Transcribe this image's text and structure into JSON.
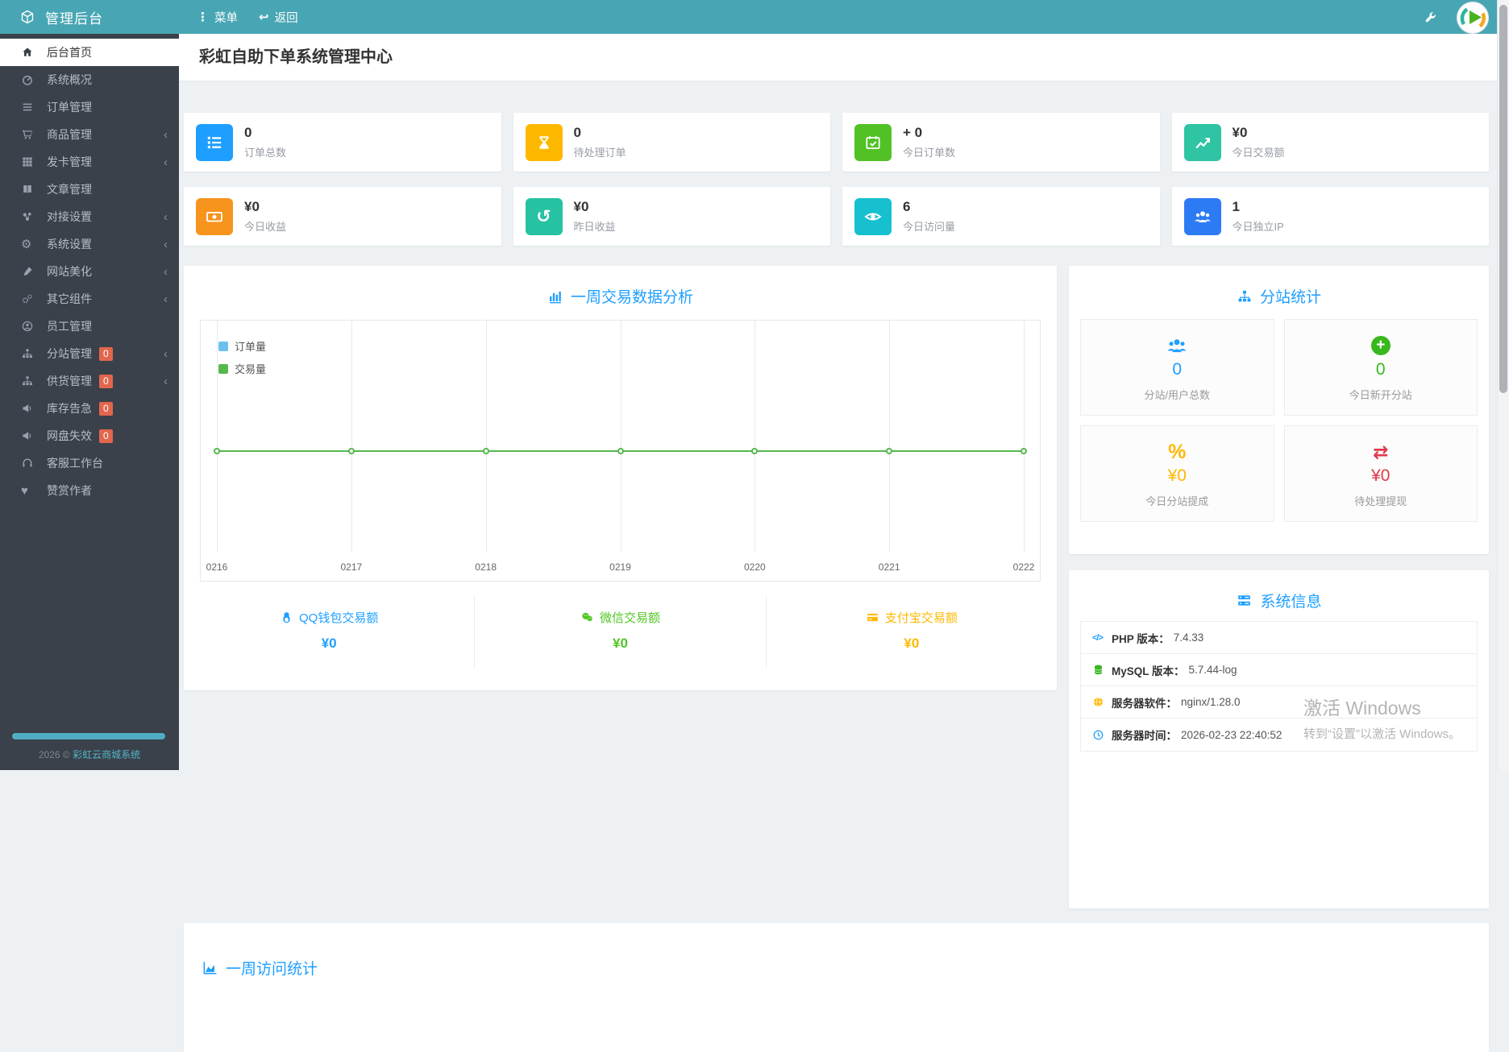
{
  "theme": {
    "accent": "#1E9FFF",
    "header": "#48A6B4",
    "sidebar": "#3A414B",
    "badge": "#E2664D",
    "body_bg": "#EEF1F4"
  },
  "header": {
    "app_title": "管理后台",
    "menu_label": "菜单",
    "back_label": "返回"
  },
  "icons": {
    "kebab": "⋮",
    "back": "↩",
    "gear": "⚙",
    "heart": "♥",
    "history": "↺",
    "exchange": "⇄",
    "percent": "%",
    "plus": "+",
    "code": "</>",
    "chevron": "‹"
  },
  "sidebar": {
    "items": [
      {
        "label": "后台首页",
        "icon": "home-icon",
        "active": true
      },
      {
        "label": "系统概况",
        "icon": "gauge-icon"
      },
      {
        "label": "订单管理",
        "icon": "list-icon"
      },
      {
        "label": "商品管理",
        "icon": "cart-icon",
        "expandable": true
      },
      {
        "label": "发卡管理",
        "icon": "grid-icon",
        "expandable": true
      },
      {
        "label": "文章管理",
        "icon": "book-icon"
      },
      {
        "label": "对接设置",
        "icon": "nodes-icon",
        "expandable": true
      },
      {
        "label": "系统设置",
        "icon": "gear-icon",
        "expandable": true
      },
      {
        "label": "网站美化",
        "icon": "brush-icon",
        "expandable": true
      },
      {
        "label": "其它组件",
        "icon": "cogs-icon",
        "expandable": true
      },
      {
        "label": "员工管理",
        "icon": "user-circle-icon"
      },
      {
        "label": "分站管理",
        "icon": "sitemap-icon",
        "badge": "0",
        "expandable": true
      },
      {
        "label": "供货管理",
        "icon": "sitemap-icon",
        "badge": "0",
        "expandable": true
      },
      {
        "label": "库存告急",
        "icon": "megaphone-icon",
        "badge": "0"
      },
      {
        "label": "网盘失效",
        "icon": "megaphone-icon",
        "badge": "0"
      },
      {
        "label": "客服工作台",
        "icon": "headset-icon"
      },
      {
        "label": "赞赏作者",
        "icon": "heart-icon"
      }
    ],
    "footer": {
      "year_text": "2026 ©",
      "brand": "彩虹云商城系统"
    }
  },
  "page": {
    "title": "彩虹自助下单系统管理中心"
  },
  "stats": [
    {
      "value": "0",
      "label": "订单总数",
      "icon": "order-list-icon",
      "color": "#1E9FFF"
    },
    {
      "value": "0",
      "label": "待处理订单",
      "icon": "hourglass-icon",
      "color": "#FFB800"
    },
    {
      "value": "+ 0",
      "label": "今日订单数",
      "icon": "calendar-check-icon",
      "color": "#52C125"
    },
    {
      "value": "¥0",
      "label": "今日交易额",
      "icon": "trend-icon",
      "color": "#2EC4A4"
    },
    {
      "value": "¥0",
      "label": "今日收益",
      "icon": "money-icon",
      "color": "#F7941D"
    },
    {
      "value": "¥0",
      "label": "昨日收益",
      "icon": "history-icon",
      "color": "#26C2A3"
    },
    {
      "value": "6",
      "label": "今日访问量",
      "icon": "eye-icon",
      "color": "#17C0CF"
    },
    {
      "value": "1",
      "label": "今日独立IP",
      "icon": "users-icon",
      "color": "#2D7BF4"
    }
  ],
  "trade_panel": {
    "title": "一周交易数据分析",
    "legend": [
      {
        "label": "订单量",
        "color": "#6CC0F0"
      },
      {
        "label": "交易量",
        "color": "#55B84E"
      }
    ],
    "payments": [
      {
        "label": "QQ钱包交易额",
        "value": "¥0",
        "color": "#1E9FFF",
        "icon": "qq-icon"
      },
      {
        "label": "微信交易额",
        "value": "¥0",
        "color": "#4FC622",
        "icon": "wechat-icon"
      },
      {
        "label": "支付宝交易额",
        "value": "¥0",
        "color": "#FFB800",
        "icon": "alipay-icon"
      }
    ]
  },
  "chart_data": {
    "type": "line",
    "title": "一周交易数据分析",
    "categories": [
      "0216",
      "0217",
      "0218",
      "0219",
      "0220",
      "0221",
      "0222"
    ],
    "series": [
      {
        "name": "订单量",
        "values": [
          0,
          0,
          0,
          0,
          0,
          0,
          0
        ]
      },
      {
        "name": "交易量",
        "values": [
          0,
          0,
          0,
          0,
          0,
          0,
          0
        ]
      }
    ],
    "legend_position": "top-left",
    "grid": "vertical-only"
  },
  "substation_panel": {
    "title": "分站统计",
    "cells": [
      {
        "value": "0",
        "label": "分站/用户总数",
        "icon": "users-group-icon",
        "color": "#1E9FFF"
      },
      {
        "value": "0",
        "label": "今日新开分站",
        "icon": "plus-circle-icon",
        "color": "#39B81D"
      },
      {
        "value": "¥0",
        "label": "今日分站提成",
        "icon": "percent-icon",
        "color": "#FFB800"
      },
      {
        "value": "¥0",
        "label": "待处理提现",
        "icon": "exchange-icon",
        "color": "#E0394B"
      }
    ]
  },
  "system_panel": {
    "title": "系统信息",
    "rows": [
      {
        "label": "PHP 版本：",
        "value": "7.4.33",
        "icon": "code-icon",
        "color": "#1E9FFF"
      },
      {
        "label": "MySQL 版本：",
        "value": "5.7.44-log",
        "icon": "database-icon",
        "color": "#36B421"
      },
      {
        "label": "服务器软件：",
        "value": "nginx/1.28.0",
        "icon": "globe-icon",
        "color": "#FFB800"
      },
      {
        "label": "服务器时间：",
        "value": "2026-02-23 22:40:52",
        "icon": "clock-icon",
        "color": "#1E9FFF"
      }
    ]
  },
  "visits_panel": {
    "title": "一周访问统计"
  },
  "watermark": {
    "line1": "激活 Windows",
    "line2": "转到“设置”以激活 Windows。"
  }
}
